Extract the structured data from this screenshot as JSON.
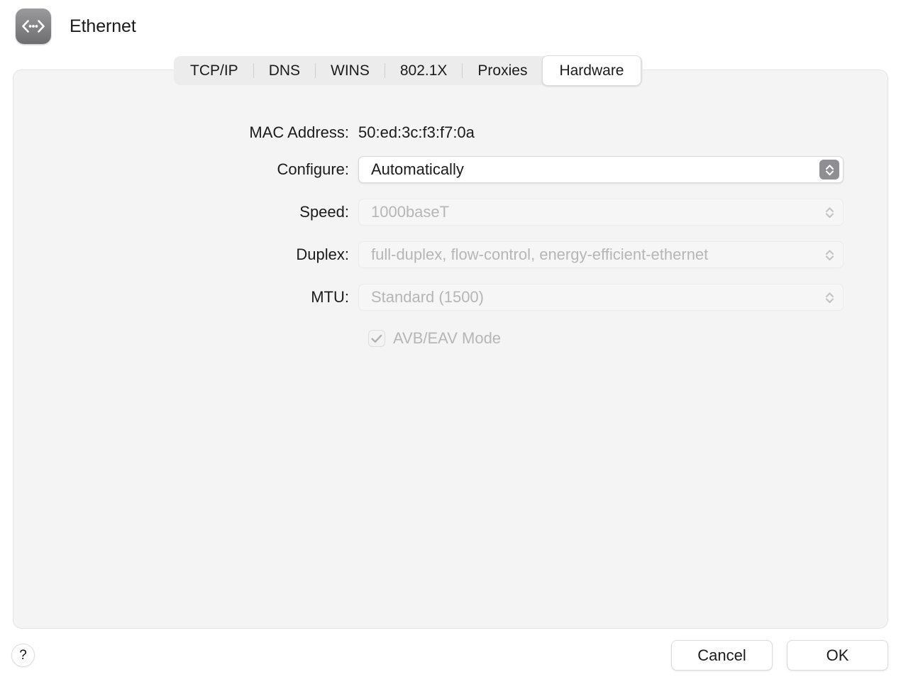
{
  "window": {
    "title": "Ethernet",
    "icon": "ethernet-network-icon"
  },
  "tabs": [
    {
      "label": "TCP/IP",
      "selected": false
    },
    {
      "label": "DNS",
      "selected": false
    },
    {
      "label": "WINS",
      "selected": false
    },
    {
      "label": "802.1X",
      "selected": false
    },
    {
      "label": "Proxies",
      "selected": false
    },
    {
      "label": "Hardware",
      "selected": true
    }
  ],
  "form": {
    "mac_address": {
      "label": "MAC Address:",
      "value": "50:ed:3c:f3:f7:0a"
    },
    "configure": {
      "label": "Configure:",
      "value": "Automatically",
      "enabled": true
    },
    "speed": {
      "label": "Speed:",
      "value": "1000baseT",
      "enabled": false
    },
    "duplex": {
      "label": "Duplex:",
      "value": "full-duplex, flow-control, energy-efficient-ethernet",
      "enabled": false
    },
    "mtu": {
      "label": "MTU:",
      "value": "Standard  (1500)",
      "enabled": false
    },
    "avb_eav": {
      "label": "AVB/EAV Mode",
      "checked": true,
      "enabled": false
    }
  },
  "footer": {
    "help_label": "?",
    "cancel_label": "Cancel",
    "ok_label": "OK"
  },
  "colors": {
    "panel_background": "#f4f4f4",
    "tabbar_background": "#ececec",
    "selected_tab_background": "#ffffff",
    "disabled_text": "#b6b6b6",
    "text": "#1b1b1b",
    "stepper_active": "#8e8e93"
  }
}
